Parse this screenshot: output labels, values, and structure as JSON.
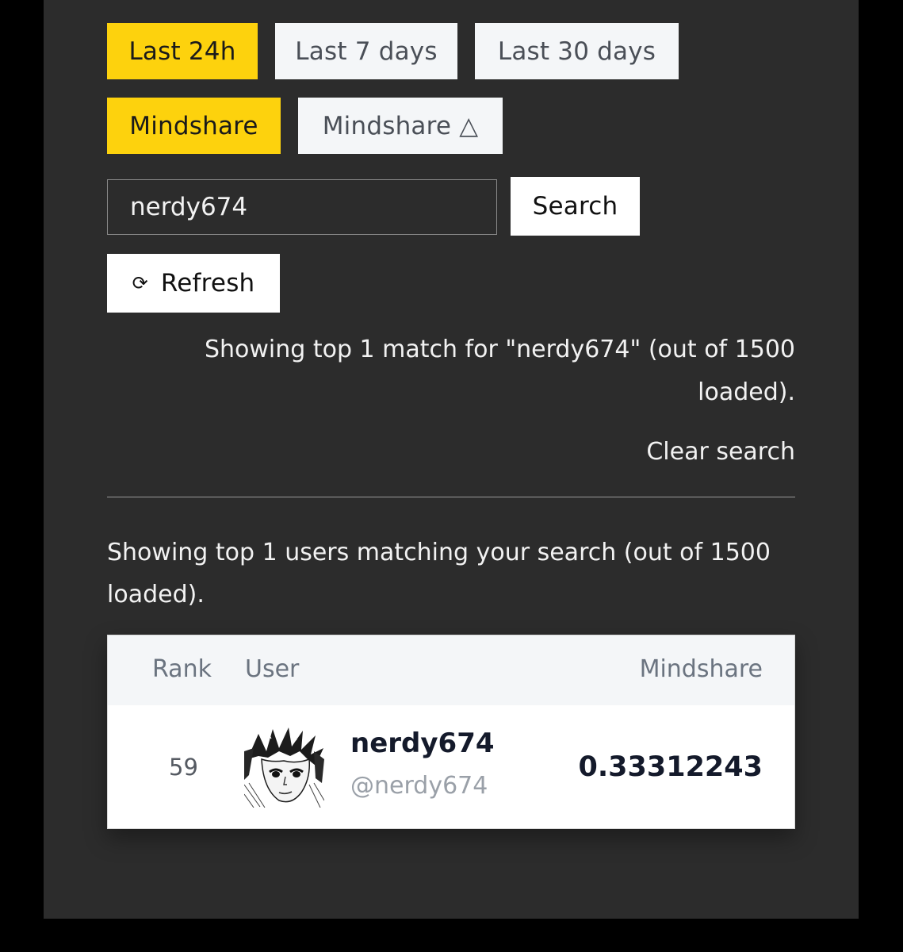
{
  "time_filters": [
    {
      "label": "Last 24h",
      "active": true
    },
    {
      "label": "Last 7 days",
      "active": false
    },
    {
      "label": "Last 30 days",
      "active": false
    }
  ],
  "metric_filters": [
    {
      "label": "Mindshare",
      "active": true
    },
    {
      "label": "Mindshare △",
      "active": false
    }
  ],
  "search": {
    "value": "nerdy674",
    "button_label": "Search"
  },
  "refresh": {
    "icon": "refresh-icon",
    "glyph": "⟳",
    "label": "Refresh"
  },
  "status": {
    "match_text_line1": "Showing top 1 match for \"nerdy674\" (out of 1500",
    "match_text_line2": "loaded).",
    "clear_label": "Clear search"
  },
  "results": {
    "summary": "Showing top 1 users matching your search (out of 1500 loaded).",
    "columns": {
      "rank": "Rank",
      "user": "User",
      "mindshare": "Mindshare"
    },
    "rows": [
      {
        "rank": "59",
        "name": "nerdy674",
        "handle": "@nerdy674",
        "mindshare": "0.33312243"
      }
    ]
  },
  "colors": {
    "accent": "#fdd20d",
    "panel": "#2c2c2c",
    "background": "#000000"
  }
}
